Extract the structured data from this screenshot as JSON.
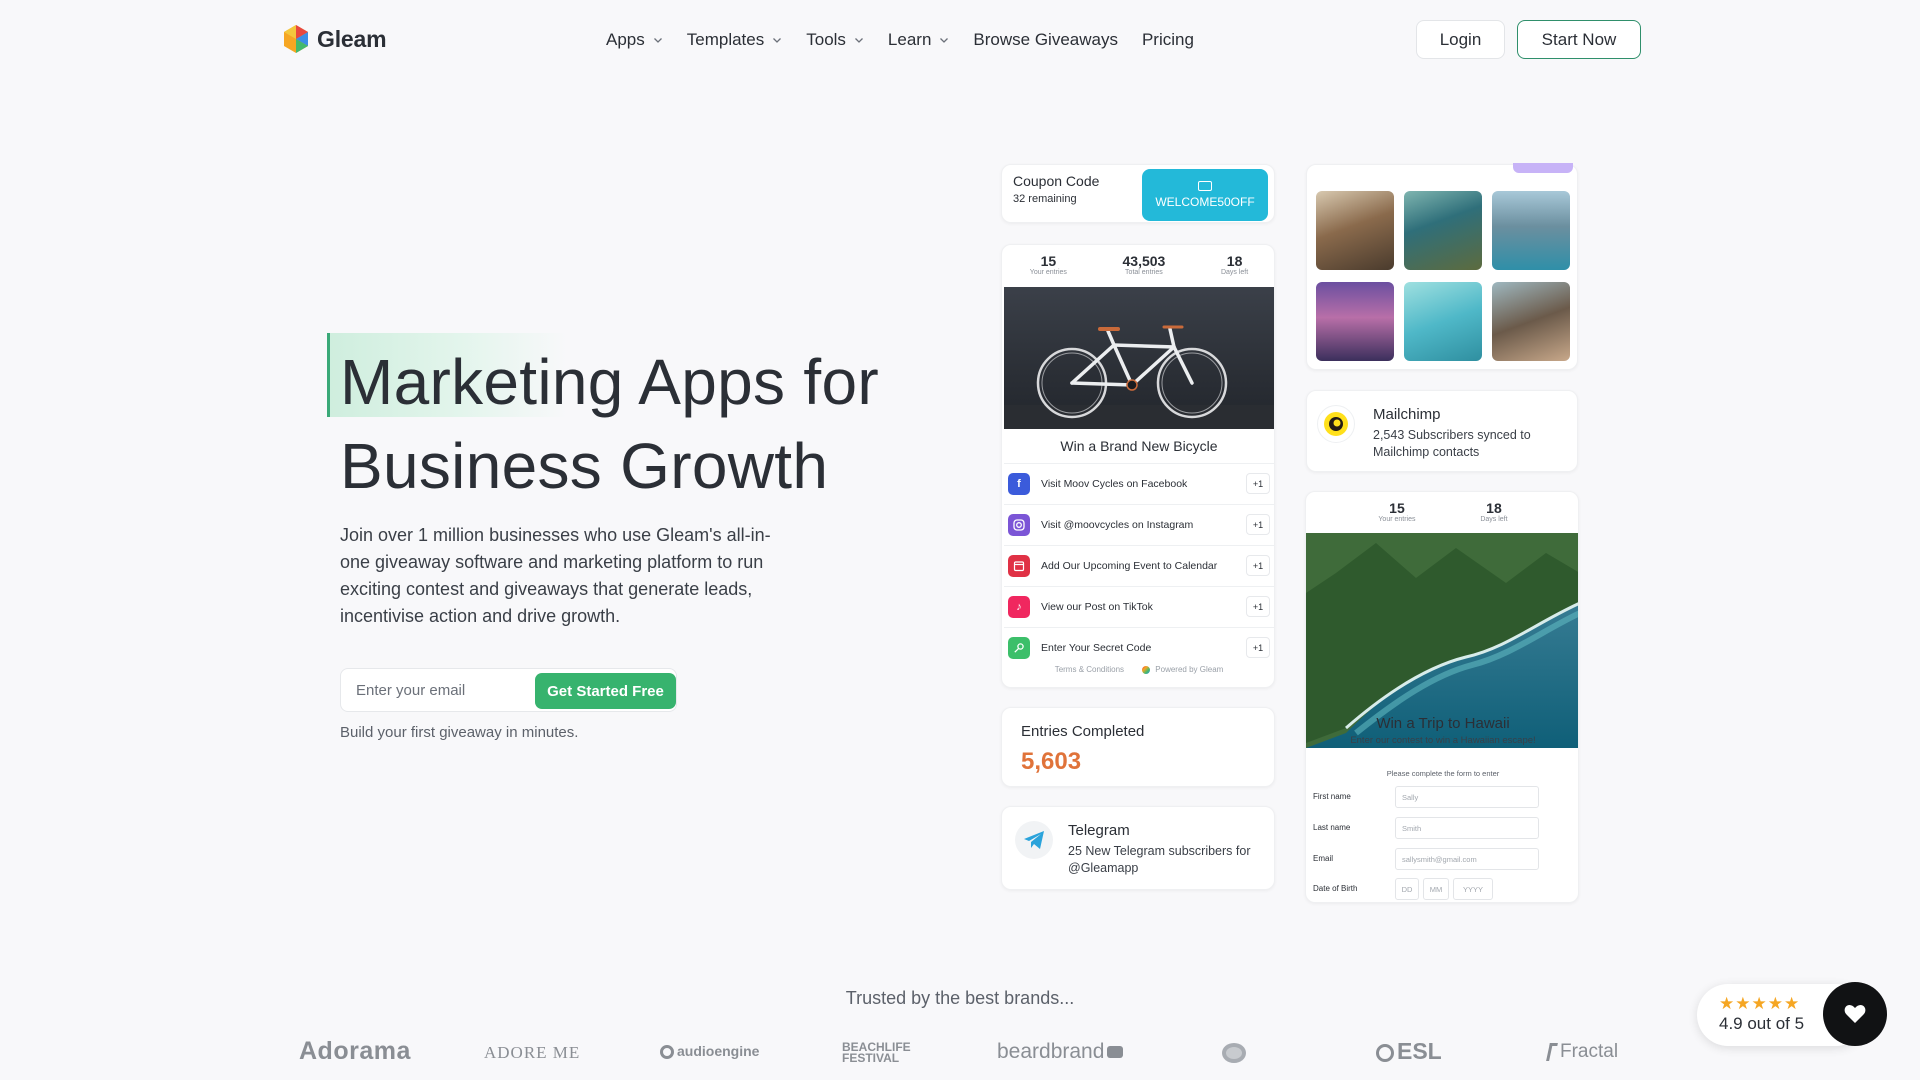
{
  "header": {
    "logo_text": "Gleam",
    "nav": [
      {
        "label": "Apps",
        "dropdown": true
      },
      {
        "label": "Templates",
        "dropdown": true
      },
      {
        "label": "Tools",
        "dropdown": true
      },
      {
        "label": "Learn",
        "dropdown": true
      },
      {
        "label": "Browse Giveaways",
        "dropdown": false
      },
      {
        "label": "Pricing",
        "dropdown": false
      }
    ],
    "login_label": "Login",
    "start_label": "Start Now"
  },
  "hero": {
    "title_line1": "Marketing Apps for",
    "title_line2": "Business Growth",
    "subtitle": "Join over 1 million businesses who use Gleam's all-in-one giveaway software and marketing platform to run exciting contest and giveaways that generate leads, incentivise action and drive growth.",
    "email_placeholder": "Enter your email",
    "cta_label": "Get Started Free",
    "note": "Build your first giveaway in minutes."
  },
  "coupon": {
    "title": "Coupon Code",
    "remaining": "32 remaining",
    "code": "WELCOME50OFF"
  },
  "bike_giveaway": {
    "stats": [
      {
        "value": "15",
        "label": "Your entries"
      },
      {
        "value": "43,503",
        "label": "Total entries"
      },
      {
        "value": "18",
        "label": "Days left"
      }
    ],
    "title": "Win a Brand New Bicycle",
    "actions": [
      {
        "text": "Visit Moov Cycles on Facebook",
        "points": "+1",
        "icon": "facebook-icon",
        "color": "#3b5bdb"
      },
      {
        "text": "Visit @moovcycles on Instagram",
        "points": "+1",
        "icon": "instagram-icon",
        "color": "#7b55d6"
      },
      {
        "text": "Add Our Upcoming Event to Calendar",
        "points": "+1",
        "icon": "calendar-icon",
        "color": "#e03145"
      },
      {
        "text": "View our Post on TikTok",
        "points": "+1",
        "icon": "tiktok-icon",
        "color": "#f0275f"
      },
      {
        "text": "Enter Your Secret Code",
        "points": "+1",
        "icon": "key-icon",
        "color": "#3cbf6a"
      }
    ],
    "footer_terms": "Terms & Conditions",
    "footer_powered": "Powered by Gleam"
  },
  "entries": {
    "label": "Entries Completed",
    "value": "5,603"
  },
  "telegram": {
    "title": "Telegram",
    "subtitle": "25 New Telegram subscribers for @Gleamapp"
  },
  "mailchimp": {
    "title": "Mailchimp",
    "subtitle": "2,543 Subscribers synced to Mailchimp contacts"
  },
  "hawaii_giveaway": {
    "stats": [
      {
        "value": "15",
        "label": "Your entries"
      },
      {
        "value": "18",
        "label": "Days left"
      }
    ],
    "title": "Win a Trip to Hawaii",
    "subtitle": "Enter our contest to win a Hawaiian escape!",
    "form_note": "Please complete the form to enter",
    "fields": [
      {
        "label": "First name",
        "placeholder": "Sally"
      },
      {
        "label": "Last name",
        "placeholder": "Smith"
      },
      {
        "label": "Email",
        "placeholder": "sallysmith@gmail.com"
      }
    ],
    "dob_label": "Date of Birth",
    "dob_parts": [
      "DD",
      "MM",
      "YYYY"
    ]
  },
  "trusted": {
    "heading": "Trusted by the best brands...",
    "brands": [
      "Adorama",
      "ADORE ME",
      "audioengine",
      "BEACHLIFE FESTIVAL",
      "beardbrand",
      "ESL",
      "Fractal"
    ]
  },
  "rating": {
    "stars": "★★★★★",
    "text": "4.9 out of 5"
  },
  "colors": {
    "accent_green": "#37b36e",
    "coupon_cyan": "#23b9d9",
    "entries_orange": "#e0733a"
  }
}
